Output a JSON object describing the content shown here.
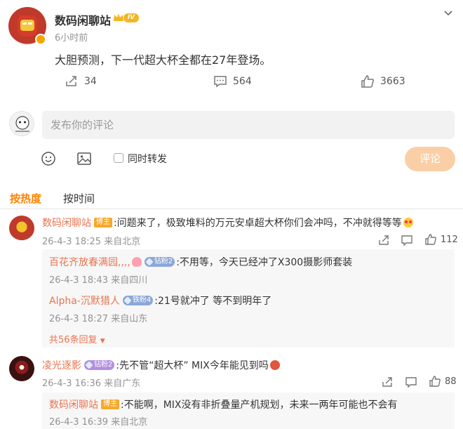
{
  "post": {
    "author": "数码闲聊站",
    "vip_level": "IV",
    "time": "6小时前",
    "text": "大胆预测，下一代超大杯全都在27年登场。",
    "reposts": "34",
    "comments": "564",
    "likes": "3663"
  },
  "composer": {
    "placeholder": "发布你的评论",
    "repost_label": "同时转发",
    "submit_label": "评论"
  },
  "sort_tabs": {
    "hot": "按热度",
    "time": "按时间"
  },
  "comments": [
    {
      "name": "数码闲聊站",
      "badge": "博主",
      "text": ":问题来了，极致堆料的万元安卓超大杯你们会冲吗，不冲就得等等",
      "meta": "26-4-3 18:25 来自北京",
      "likes": "112",
      "replies": [
        {
          "name": "百花齐放春满园,,,,",
          "badge": "钻粉2",
          "text": ":不用等，今天已经冲了X300摄影师套装",
          "meta": "26-4-3 18:43 来自四川"
        },
        {
          "name": "Alpha-沉默猎人",
          "badge": "铁粉4",
          "text": ":21号就冲了  等不到明年了",
          "meta": "26-4-3 18:27 来自山东"
        }
      ],
      "more_replies": "共56条回复"
    },
    {
      "name": "凌光逐影",
      "badge": "钻粉2",
      "text": ":先不管“超大杯” MIX今年能见到吗",
      "meta": "26-4-3 16:36 来自广东",
      "likes": "88",
      "replies": [
        {
          "name": "数码闲聊站",
          "badge": "博主",
          "text": ":不能啊，MIX没有非折叠量产机规划，未来一两年可能也不会有",
          "meta": "26-4-3 16:39 来自北京"
        }
      ]
    }
  ],
  "colors": {
    "accent": "#ff8200",
    "name": "#eb7350",
    "submit_disabled": "#fbcfa6",
    "muted": "#939393"
  }
}
